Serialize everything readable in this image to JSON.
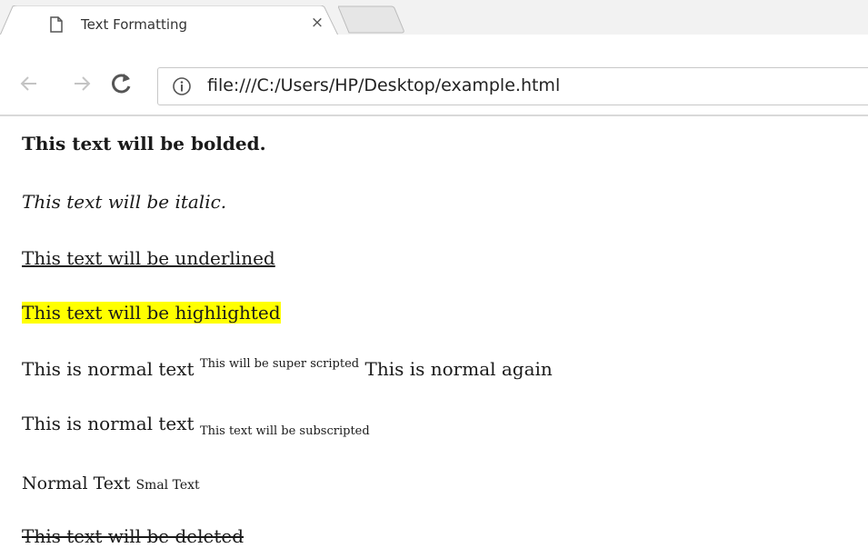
{
  "browser": {
    "tab": {
      "title": "Text Formatting",
      "close": "×"
    },
    "address": {
      "url": "file:///C:/Users/HP/Desktop/example.html"
    }
  },
  "page": {
    "bold": "This text will be bolded.",
    "italic": "This text will be italic.",
    "underlined": "This text will be underlined",
    "highlighted": "This text will be highlighted",
    "superscript_line": {
      "before": "This is normal text",
      "sup": "This will be super scripted",
      "after": "This is normal again"
    },
    "subscript_line": {
      "before": "This is normal text",
      "sub": "This text will be subscripted"
    },
    "small_line": {
      "normal": "Normal Text",
      "small": "Smal Text"
    },
    "deleted": "This text will be deleted"
  },
  "colors": {
    "highlight": "#ffff00",
    "tabbar": "#f2f2f2"
  }
}
